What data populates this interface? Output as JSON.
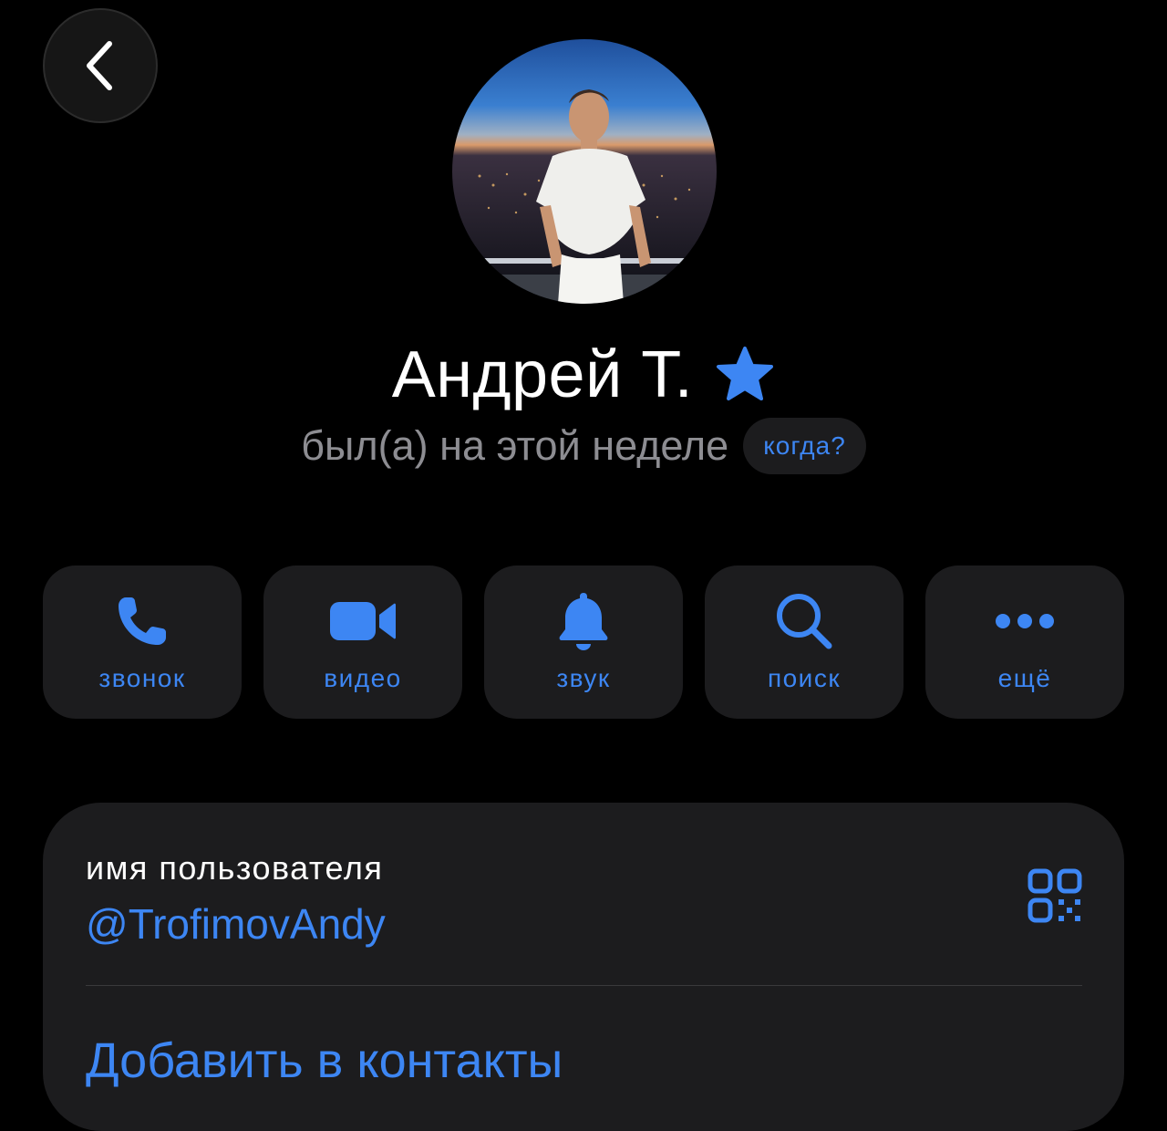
{
  "header": {
    "back_icon": "chevron-left-icon"
  },
  "profile": {
    "avatar_icon": "profile-photo",
    "name": "Андрей Т.",
    "badge_icon": "star-icon",
    "status": "был(а) на этой неделе",
    "when_label": "когда?"
  },
  "actions": [
    {
      "label": "звонок",
      "icon": "phone-icon"
    },
    {
      "label": "видео",
      "icon": "video-camera-icon"
    },
    {
      "label": "звук",
      "icon": "bell-icon"
    },
    {
      "label": "поиск",
      "icon": "search-icon"
    },
    {
      "label": "ещё",
      "icon": "more-dots-icon"
    }
  ],
  "info": {
    "username_label": "имя пользователя",
    "username": "@TrofimovAndy",
    "qr_icon": "qr-code-icon",
    "add_contact": "Добавить в контакты"
  },
  "colors": {
    "background": "#000000",
    "surface": "#1c1c1e",
    "accent": "#3d86f3",
    "secondary_text": "#8d8d92"
  }
}
